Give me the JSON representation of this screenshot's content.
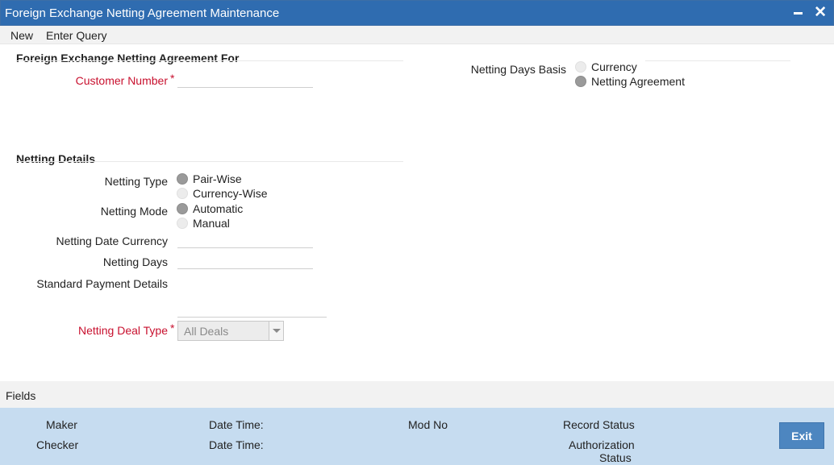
{
  "window": {
    "title": "Foreign Exchange Netting Agreement Maintenance",
    "close_glyph": "✕"
  },
  "menu": {
    "new": "New",
    "enter_query": "Enter Query"
  },
  "agreement_section": {
    "title": "Foreign Exchange Netting Agreement For",
    "customer_number_label": "Customer Number",
    "customer_number_value": "",
    "required_marker": "*"
  },
  "netting_days_basis": {
    "label": "Netting Days Basis",
    "options": [
      {
        "label": "Currency",
        "checked": false
      },
      {
        "label": "Netting Agreement",
        "checked": true
      }
    ]
  },
  "netting_details": {
    "title": "Netting Details",
    "netting_type_label": "Netting Type",
    "netting_type_options": [
      {
        "label": "Pair-Wise",
        "checked": true
      },
      {
        "label": "Currency-Wise",
        "checked": false
      }
    ],
    "netting_mode_label": "Netting Mode",
    "netting_mode_options": [
      {
        "label": "Automatic",
        "checked": true
      },
      {
        "label": "Manual",
        "checked": false
      }
    ],
    "netting_date_currency_label": "Netting Date Currency",
    "netting_date_currency_value": "",
    "netting_days_label": "Netting Days",
    "netting_days_value": "",
    "standard_payment_details_label": "Standard Payment Details",
    "standard_payment_details_value": "",
    "netting_deal_type_label": "Netting Deal Type",
    "netting_deal_type_value": "All Deals",
    "required_marker": "*"
  },
  "fields_bar": {
    "label": "Fields"
  },
  "footer": {
    "maker": "Maker",
    "checker": "Checker",
    "date_time_1": "Date Time:",
    "date_time_2": "Date Time:",
    "mod_no": "Mod No",
    "record_status": "Record Status",
    "authorization": "Authorization",
    "status": "Status",
    "exit": "Exit"
  },
  "colors": {
    "titlebar": "#2f6cb0",
    "footer": "#c6dcf0",
    "required": "#c8102e",
    "exit_button": "#4d86c0"
  }
}
